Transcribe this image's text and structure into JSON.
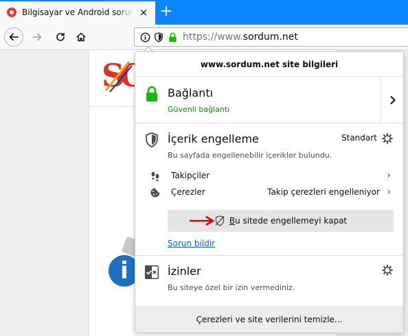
{
  "tab": {
    "title": "Bilgisayar ve Android sorunlarına",
    "close": "×",
    "new_tab": "+"
  },
  "nav": {
    "url_scheme": "https://www.",
    "url_domain": "sordum.net"
  },
  "panel": {
    "header": "www.sordum.net site bilgileri",
    "connection": {
      "title": "Bağlantı",
      "status": "Güvenli bağlantı",
      "status_color": "#058b00"
    },
    "blocking": {
      "title": "İçerik engelleme",
      "mode": "Standart",
      "description": "Bu sayfada engellenebilir içerikler bulundu.",
      "rows": [
        {
          "label": "Takipçiler",
          "status": ""
        },
        {
          "label": "Çerezler",
          "status": "Takip çerezleri engelleniyor"
        }
      ],
      "disable_button": "Bu sitede engellemeyi kapat",
      "report_link": "Sorun bildir"
    },
    "permissions": {
      "title": "İzinler",
      "description": "Bu siteye özel bir izin vermediniz."
    },
    "footer": "Çerezleri ve site verilerini temizle..."
  },
  "colors": {
    "tabstrip": "#0a84ff",
    "lock_green": "#12bc00",
    "arrow_red": "#e00000",
    "link_blue": "#0060df"
  }
}
